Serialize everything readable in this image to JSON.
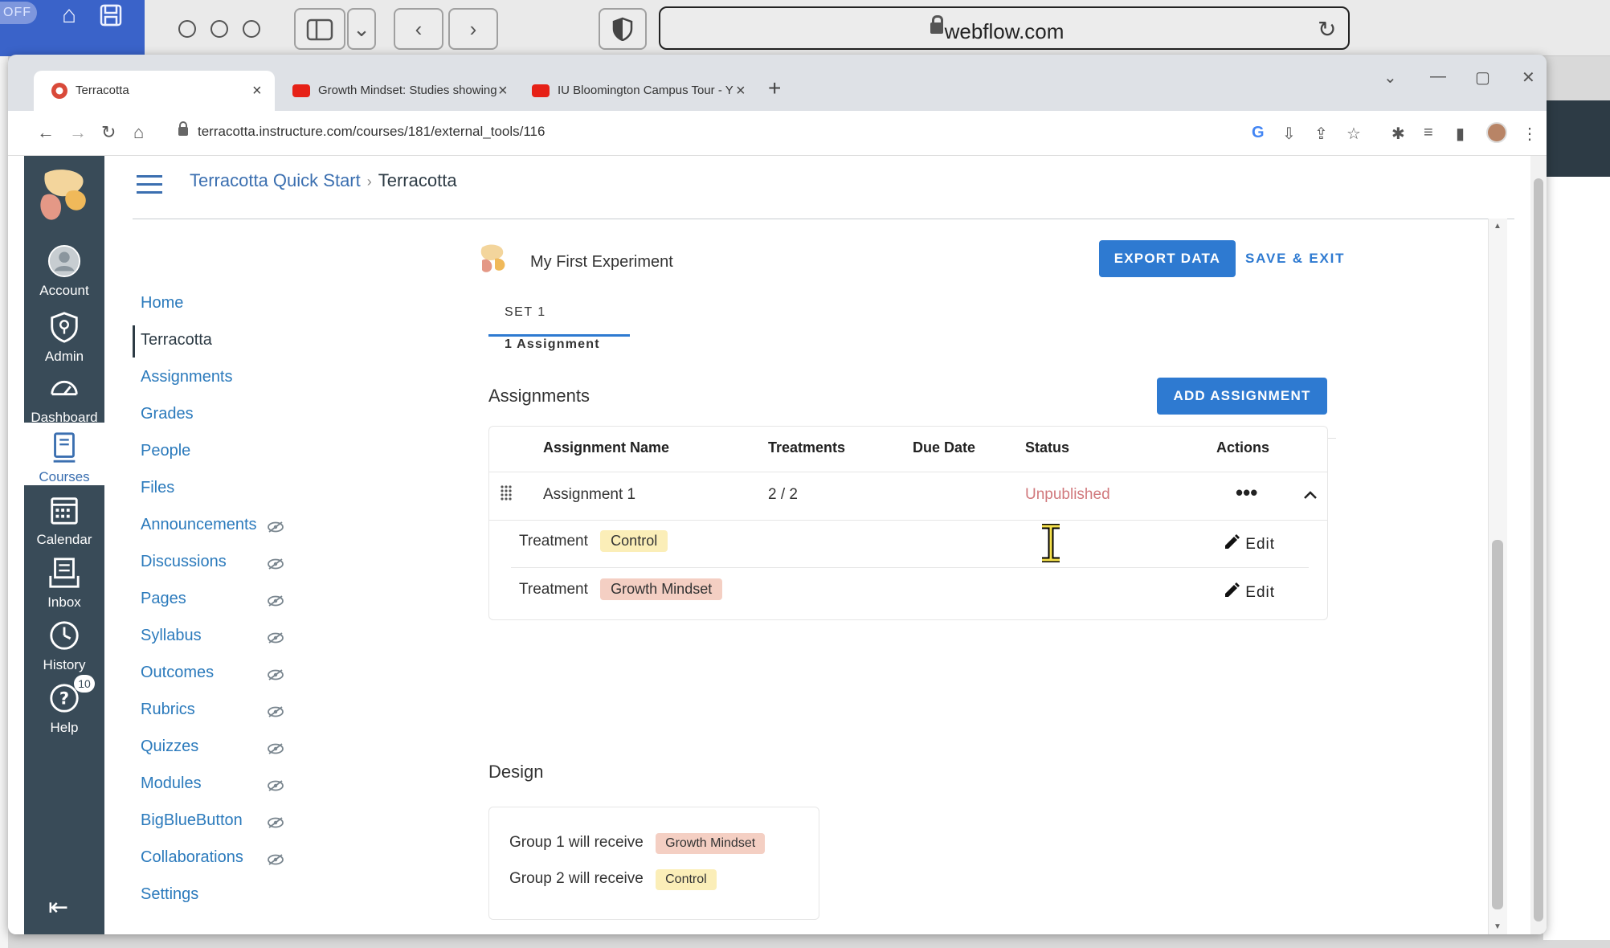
{
  "safari": {
    "off_label": "OFF",
    "url": "webflow.com"
  },
  "browser": {
    "tabs": [
      {
        "title": "Terracotta",
        "active": true
      },
      {
        "title": "Growth Mindset: Studies showing",
        "active": false
      },
      {
        "title": "IU Bloomington Campus Tour - Y",
        "active": false
      }
    ],
    "address": "terracotta.instructure.com/courses/181/external_tools/116"
  },
  "global_nav": {
    "items": [
      {
        "label": "Account",
        "icon": "account-icon"
      },
      {
        "label": "Admin",
        "icon": "admin-icon"
      },
      {
        "label": "Dashboard",
        "icon": "dashboard-icon"
      },
      {
        "label": "Courses",
        "icon": "courses-icon",
        "active": true
      },
      {
        "label": "Calendar",
        "icon": "calendar-icon"
      },
      {
        "label": "Inbox",
        "icon": "inbox-icon"
      },
      {
        "label": "History",
        "icon": "history-icon"
      },
      {
        "label": "Help",
        "icon": "help-icon",
        "badge": "10"
      }
    ]
  },
  "breadcrumb": {
    "course": "Terracotta Quick Start",
    "separator": "›",
    "current": "Terracotta"
  },
  "course_nav": {
    "items": [
      {
        "label": "Home",
        "hidden": false
      },
      {
        "label": "Terracotta",
        "hidden": false,
        "active": true
      },
      {
        "label": "Assignments",
        "hidden": false
      },
      {
        "label": "Grades",
        "hidden": false
      },
      {
        "label": "People",
        "hidden": false
      },
      {
        "label": "Files",
        "hidden": false
      },
      {
        "label": "Announcements",
        "hidden": true
      },
      {
        "label": "Discussions",
        "hidden": true
      },
      {
        "label": "Pages",
        "hidden": true
      },
      {
        "label": "Syllabus",
        "hidden": true
      },
      {
        "label": "Outcomes",
        "hidden": true
      },
      {
        "label": "Rubrics",
        "hidden": true
      },
      {
        "label": "Quizzes",
        "hidden": true
      },
      {
        "label": "Modules",
        "hidden": true
      },
      {
        "label": "BigBlueButton",
        "hidden": true
      },
      {
        "label": "Collaborations",
        "hidden": true
      },
      {
        "label": "Settings",
        "hidden": false
      }
    ]
  },
  "experiment": {
    "title": "My First Experiment",
    "export_label": "EXPORT DATA",
    "save_label": "SAVE & EXIT",
    "set_label": "SET 1",
    "set_count": "1 Assignment"
  },
  "assignments": {
    "section_title": "Assignments",
    "add_label": "ADD ASSIGNMENT",
    "columns": [
      "Assignment Name",
      "Treatments",
      "Due Date",
      "Status",
      "Actions"
    ],
    "rows": [
      {
        "name": "Assignment 1",
        "treatments": "2 / 2",
        "due_date": "",
        "status": "Unpublished",
        "treatment_rows": [
          {
            "label": "Treatment",
            "condition": "Control",
            "edit": "Edit"
          },
          {
            "label": "Treatment",
            "condition": "Growth Mindset",
            "edit": "Edit"
          }
        ]
      }
    ]
  },
  "design": {
    "section_title": "Design",
    "groups": [
      {
        "text": "Group 1 will receive",
        "condition": "Growth Mindset"
      },
      {
        "text": "Group 2 will receive",
        "condition": "Control"
      }
    ]
  },
  "colors": {
    "canvas_nav": "#394b58",
    "link": "#2b7abc",
    "primary_button": "#2e7ad1",
    "control_pill": "#fbeeb8",
    "growth_pill": "#f4cfc3",
    "unpublished": "#d1797d"
  }
}
